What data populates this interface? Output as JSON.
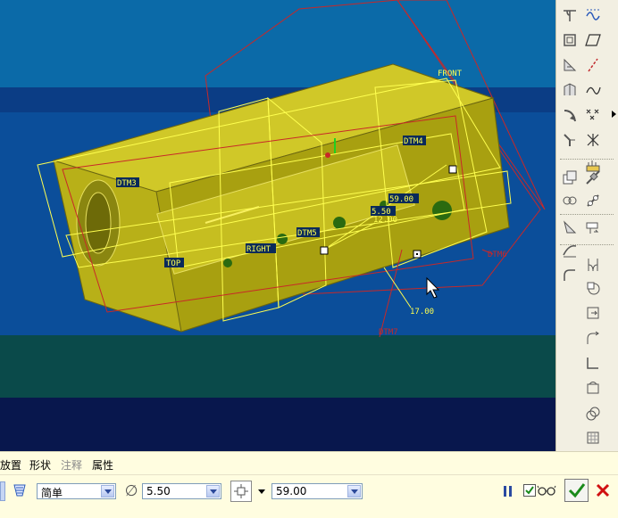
{
  "viewport": {
    "datum_labels": {
      "front": "FRONT",
      "right": "RIGHT",
      "top": "TOP",
      "dtm3": "DTM3",
      "dtm4": "DTM4",
      "dtm5": "DTM5",
      "dtm6": "DTM6",
      "dtm7": "DTM7"
    },
    "dimensions": {
      "depth": "59.00",
      "diameter": "5.50",
      "offset": "12.00",
      "angle": "17.00"
    },
    "colors": {
      "sky_top": "#0b6aa8",
      "band_dark": "#0b3d85",
      "floor": "#0a4a4a",
      "bottom": "#08174d",
      "body": "#c8c020",
      "datum_plane": "#c82828",
      "datum_plane_yellow": "#ffff50"
    }
  },
  "right_toolbar": {
    "icons": [
      "sketch-plane-icon",
      "spline-icon",
      "shell-icon",
      "datum-plane-icon",
      "draft-icon",
      "datum-axis-icon",
      "rib-icon",
      "datum-curve-icon",
      "round-icon",
      "datum-point-icon",
      "chamfer-icon",
      "coordinate-system-icon",
      "analysis-icon",
      "copy-icon",
      "mirror-icon",
      "merge-icon",
      "trim-icon",
      "pattern-icon",
      "offset-icon",
      "extend-icon",
      "intersect-icon",
      "thicken-icon",
      "solidify-icon",
      "project-icon",
      "wrap-icon",
      "extrude-icon",
      "revolve-icon",
      "sweep-icon",
      "blend-icon",
      "hole-icon",
      "boundary-blend-icon",
      "style-icon",
      "warp-icon"
    ]
  },
  "dashboard": {
    "tabs": [
      "放置",
      "形状",
      "注释",
      "属性"
    ],
    "hole_type": "简单",
    "diameter_symbol": "∅",
    "diameter": "5.50",
    "depth": "59.00",
    "accent": "#1a8a1a",
    "cancel_color": "#d01010"
  }
}
